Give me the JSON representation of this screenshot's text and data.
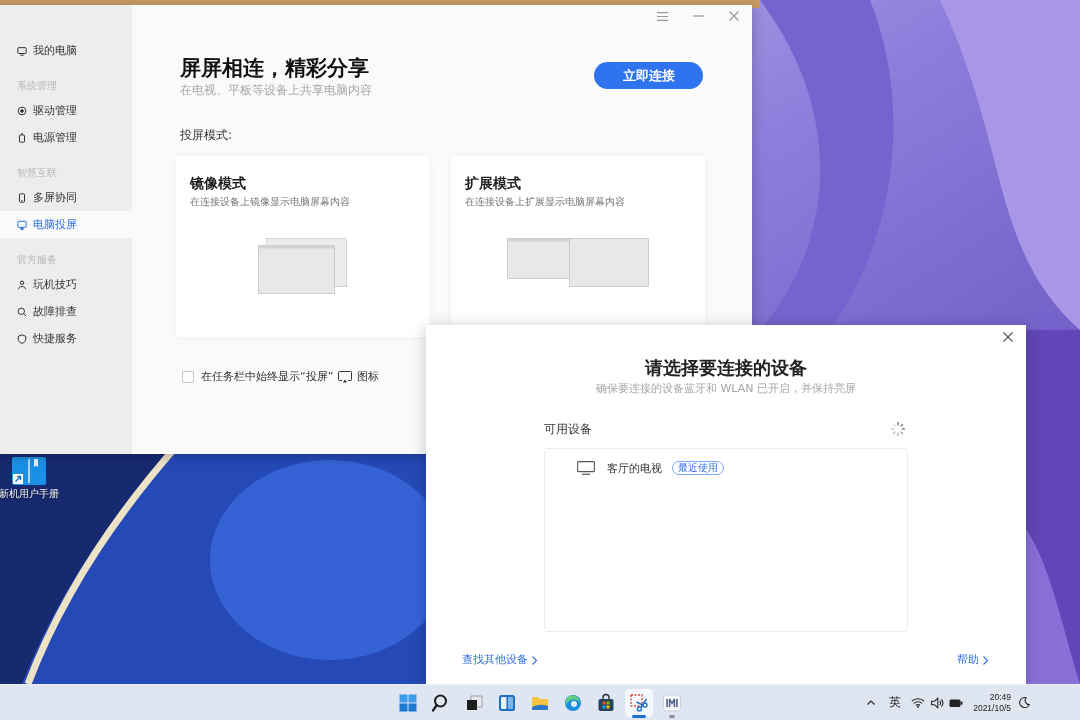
{
  "desktop": {
    "shortcut": {
      "label": "新机用户手册"
    }
  },
  "main_window": {
    "sidebar": {
      "groups": [
        {
          "items": [
            {
              "label": "我的电脑",
              "selected": false
            }
          ]
        },
        {
          "title": "系统管理",
          "items": [
            {
              "label": "驱动管理",
              "selected": false
            },
            {
              "label": "电源管理",
              "selected": false
            }
          ]
        },
        {
          "title": "智慧互联",
          "items": [
            {
              "label": "多屏协同",
              "selected": false
            },
            {
              "label": "电脑投屏",
              "selected": true
            }
          ]
        },
        {
          "title": "官方服务",
          "items": [
            {
              "label": "玩机技巧",
              "selected": false
            },
            {
              "label": "故障排查",
              "selected": false
            },
            {
              "label": "快捷服务",
              "selected": false
            }
          ]
        }
      ]
    },
    "header": {
      "title": "屏屏相连，精彩分享",
      "subtitle": "在电视、平板等设备上共享电脑内容",
      "button": "立即连接"
    },
    "modes_label": "投屏模式:",
    "modes": [
      {
        "kind": "mirror",
        "title": "镜像模式",
        "description": "在连接设备上镜像显示电脑屏幕内容"
      },
      {
        "kind": "extend",
        "title": "扩展模式",
        "description": "在连接设备上扩展显示电脑屏幕内容"
      }
    ],
    "taskbar_option": {
      "checked": false,
      "label": "在任务栏中始终显示“投屏”",
      "label_after_icon": "图标"
    }
  },
  "dialog": {
    "title": "请选择要连接的设备",
    "subtitle": "确保要连接的设备蓝牙和 WLAN 已开启，并保持亮屏",
    "list_label": "可用设备",
    "devices": [
      {
        "name": "客厅的电视",
        "badge": "最近使用"
      }
    ],
    "links": [
      "查找其他设备",
      "帮助"
    ]
  },
  "taskbar": {
    "apps": [
      {
        "active": false,
        "running": false
      },
      {
        "active": false,
        "running": false
      },
      {
        "active": false,
        "running": false
      },
      {
        "active": false,
        "running": false
      },
      {
        "active": false,
        "running": false
      },
      {
        "active": false,
        "running": false
      },
      {
        "active": false,
        "running": false
      },
      {
        "active": true,
        "running": true
      },
      {
        "active": false,
        "running": true
      }
    ],
    "tray": {
      "input_method": "英",
      "time": "20:49",
      "date": "2021/10/5"
    }
  }
}
